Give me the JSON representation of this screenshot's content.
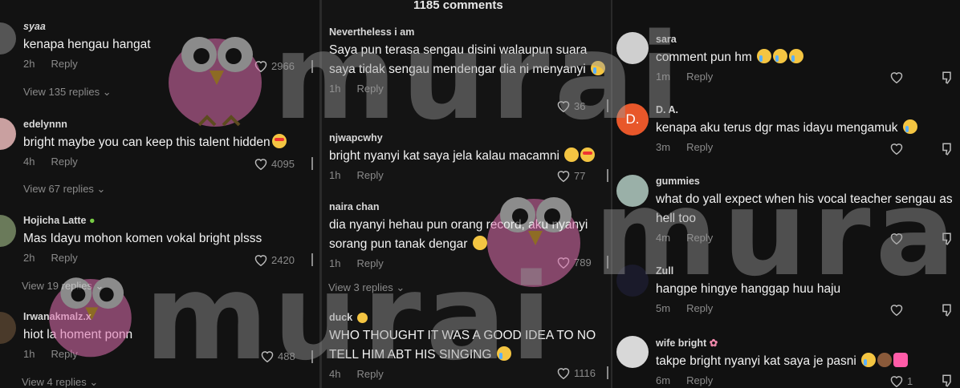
{
  "panel1": {
    "comments": [
      {
        "user": "syaa",
        "text": "kenapa hengau hangat",
        "time": "2h",
        "reply": "Reply",
        "likes": "2966",
        "views": "View 135 replies"
      },
      {
        "user": "edelynnn",
        "text": "bright maybe you can keep this talent hidden",
        "time": "4h",
        "reply": "Reply",
        "likes": "4095",
        "views": "View 67 replies"
      },
      {
        "user": "Hojicha Latte",
        "text": "Mas Idayu mohon komen vokal bright plsss",
        "time": "2h",
        "reply": "Reply",
        "likes": "2420",
        "views": "View 19 replies"
      },
      {
        "user": "Irwanakmalz.x",
        "text": "hiot la homent ponn",
        "time": "1h",
        "reply": "Reply",
        "likes": "488",
        "views": "View 4 replies"
      }
    ]
  },
  "panel2": {
    "header": "1185 comments",
    "comments": [
      {
        "user": "Nevertheless i am",
        "text": "Saya pun terasa sengau disini walaupun suara saya tidak sengau mendengar dia ni menyanyi",
        "time": "1h",
        "reply": "Reply",
        "likes": "36"
      },
      {
        "user": "njwapcwhy",
        "text": "bright nyanyi kat saya jela kalau macamni",
        "time": "1h",
        "reply": "Reply",
        "likes": "77"
      },
      {
        "user": "naira chan",
        "text": "dia nyanyi hehau pun orang record, aku nyanyi sorang pun tanak dengar",
        "time": "1h",
        "reply": "Reply",
        "likes": "789",
        "views": "View 3 replies"
      },
      {
        "user": "duck",
        "text": "WHO THOUGHT IT WAS A GOOD IDEA TO NO TELL HIM ABT HIS SINGING",
        "time": "4h",
        "reply": "Reply",
        "likes": "1116"
      }
    ]
  },
  "panel3": {
    "comments": [
      {
        "user": "sara",
        "text": "comment pun hm",
        "time": "1m",
        "reply": "Reply"
      },
      {
        "user": "D. A.",
        "avatar_letter": "D.",
        "text": "kenapa aku terus dgr mas idayu mengamuk",
        "time": "3m",
        "reply": "Reply"
      },
      {
        "user": "gummies",
        "text": "what do yall expect when his vocal teacher sengau as hell too",
        "time": "4m",
        "reply": "Reply"
      },
      {
        "user": "Zull",
        "text": "hangpe hingye hanggap huu haju",
        "time": "5m",
        "reply": "Reply"
      },
      {
        "user": "wife bright",
        "text": "takpe bright nyanyi kat saya je pasni",
        "time": "6m",
        "reply": "Reply",
        "likes": "1"
      }
    ]
  },
  "watermark": {
    "text": "murai"
  },
  "colors": {
    "bg": "#121212",
    "muted": "#8a8a8a",
    "avatar_orange": "#e8572a"
  }
}
